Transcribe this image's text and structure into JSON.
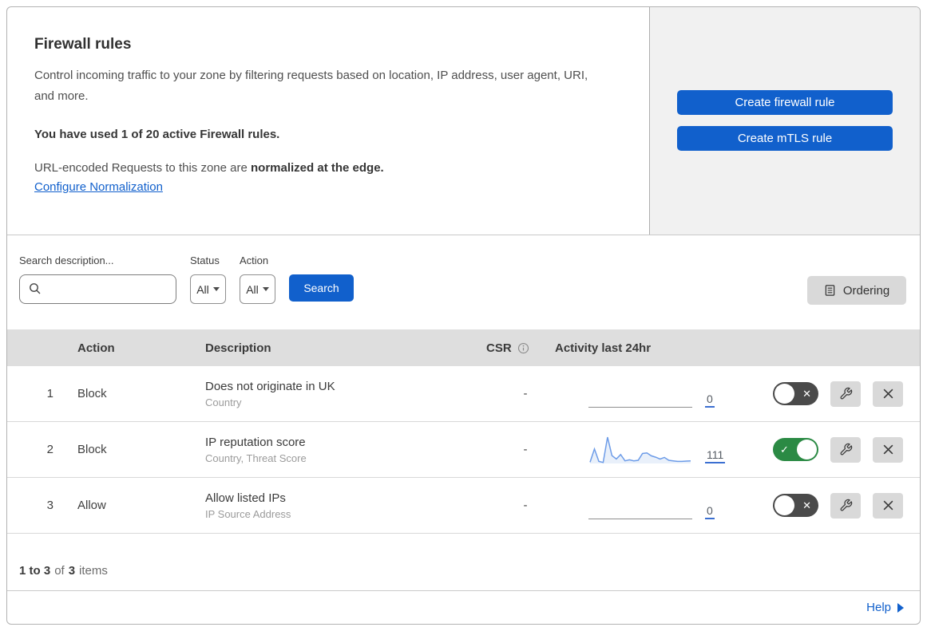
{
  "header": {
    "title": "Firewall rules",
    "description": "Control incoming traffic to your zone by filtering requests based on location, IP address, user agent, URI, and more.",
    "usage_note": "You have used 1 of 20 active Firewall rules.",
    "normalization_prefix": "URL-encoded Requests to this zone are",
    "normalization_bold": "normalized at the edge.",
    "normalization_link": "Configure Normalization"
  },
  "actions_panel": {
    "create_firewall_rule": "Create firewall rule",
    "create_mtls_rule": "Create mTLS rule"
  },
  "filters": {
    "search_label": "Search description...",
    "status_label": "Status",
    "status_value": "All",
    "action_label": "Action",
    "action_value": "All",
    "search_button": "Search",
    "ordering_button": "Ordering"
  },
  "table": {
    "headers": {
      "action": "Action",
      "description": "Description",
      "csr": "CSR",
      "activity": "Activity last 24hr"
    },
    "rows": [
      {
        "index": "1",
        "action": "Block",
        "description": "Does not originate in UK",
        "criteria": "Country",
        "csr": "-",
        "activity_count": "0",
        "enabled": false,
        "sparkline": []
      },
      {
        "index": "2",
        "action": "Block",
        "description": "IP reputation score",
        "criteria": "Country, Threat Score",
        "csr": "-",
        "activity_count": "111",
        "enabled": true,
        "sparkline": [
          5,
          55,
          8,
          4,
          100,
          30,
          17,
          34,
          10,
          14,
          10,
          12,
          38,
          40,
          29,
          24,
          17,
          23,
          12,
          10,
          8,
          8,
          9,
          10
        ]
      },
      {
        "index": "3",
        "action": "Allow",
        "description": "Allow listed IPs",
        "criteria": "IP Source Address",
        "csr": "-",
        "activity_count": "0",
        "enabled": false,
        "sparkline": []
      }
    ]
  },
  "footer": {
    "range": "1 to 3",
    "of": "of",
    "total": "3",
    "items_label": "items"
  },
  "help": {
    "label": "Help"
  },
  "colors": {
    "accent_blue": "#1160cc",
    "link_blue": "#1160cc",
    "toggle_on_green": "#2b8a44",
    "toggle_off_gray": "#4a4a4a",
    "side_panel_gray": "#f1f1f1",
    "table_header_gray": "#dedede",
    "sparkline_stroke": "#6d9ce8",
    "sparkline_fill": "#e9f0fa"
  }
}
